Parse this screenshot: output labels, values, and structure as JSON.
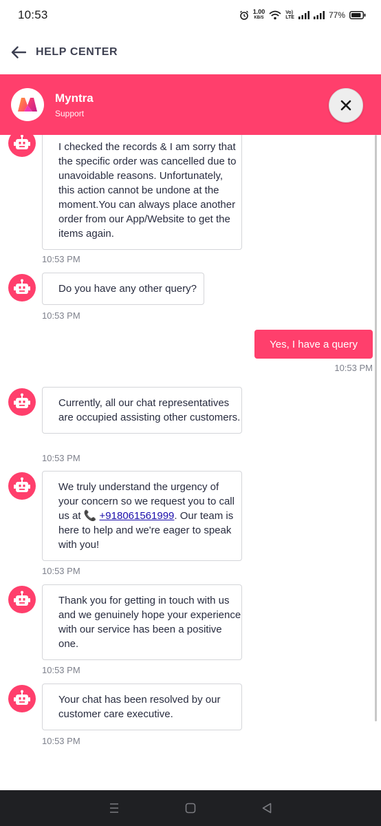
{
  "status_bar": {
    "time": "10:53",
    "net_speed_value": "1.00",
    "net_speed_unit": "KB/S",
    "volte_top": "Vo)",
    "volte_bottom": "LTE",
    "battery": "77%"
  },
  "header": {
    "title": "HELP CENTER"
  },
  "chat_header": {
    "brand_name": "Myntra",
    "subtitle": "Support",
    "accent_color": "#ff3f6c"
  },
  "messages": {
    "m1": {
      "sender": "bot",
      "text": "I checked the records & I am sorry that the specific order was cancelled due to unavoidable reasons. Unfortunately, this action cannot be undone at the moment.You can always place another order from our App/Website to get the items again.",
      "time": "10:53 PM"
    },
    "m2": {
      "sender": "bot",
      "text": "Do you have any other query?",
      "time": "10:53 PM"
    },
    "m3": {
      "sender": "user",
      "text": "Yes, I have a query",
      "time": "10:53 PM"
    },
    "m4": {
      "sender": "bot",
      "text": "Currently, all our chat representatives are occupied assisting other customers.",
      "time": "10:53 PM"
    },
    "m5": {
      "sender": "bot",
      "text_before": "We truly understand the urgency of your concern so we request you to call us at 📞 ",
      "phone": "+918061561999",
      "text_after": ". Our team is here to help and we're eager to speak with you!",
      "time": "10:53 PM"
    },
    "m6": {
      "sender": "bot",
      "text": "Thank you for getting in touch with us and we genuinely hope your experience with our service has been a positive one.",
      "time": "10:53 PM"
    },
    "m7": {
      "sender": "bot",
      "text": "Your chat has been resolved by our customer care executive.",
      "time": "10:53 PM"
    }
  },
  "icons": {
    "back": "arrow-left-icon",
    "close": "close-icon",
    "bot": "robot-icon",
    "nav_menu": "menu-icon",
    "nav_home": "home-square-icon",
    "nav_back": "triangle-back-icon"
  }
}
